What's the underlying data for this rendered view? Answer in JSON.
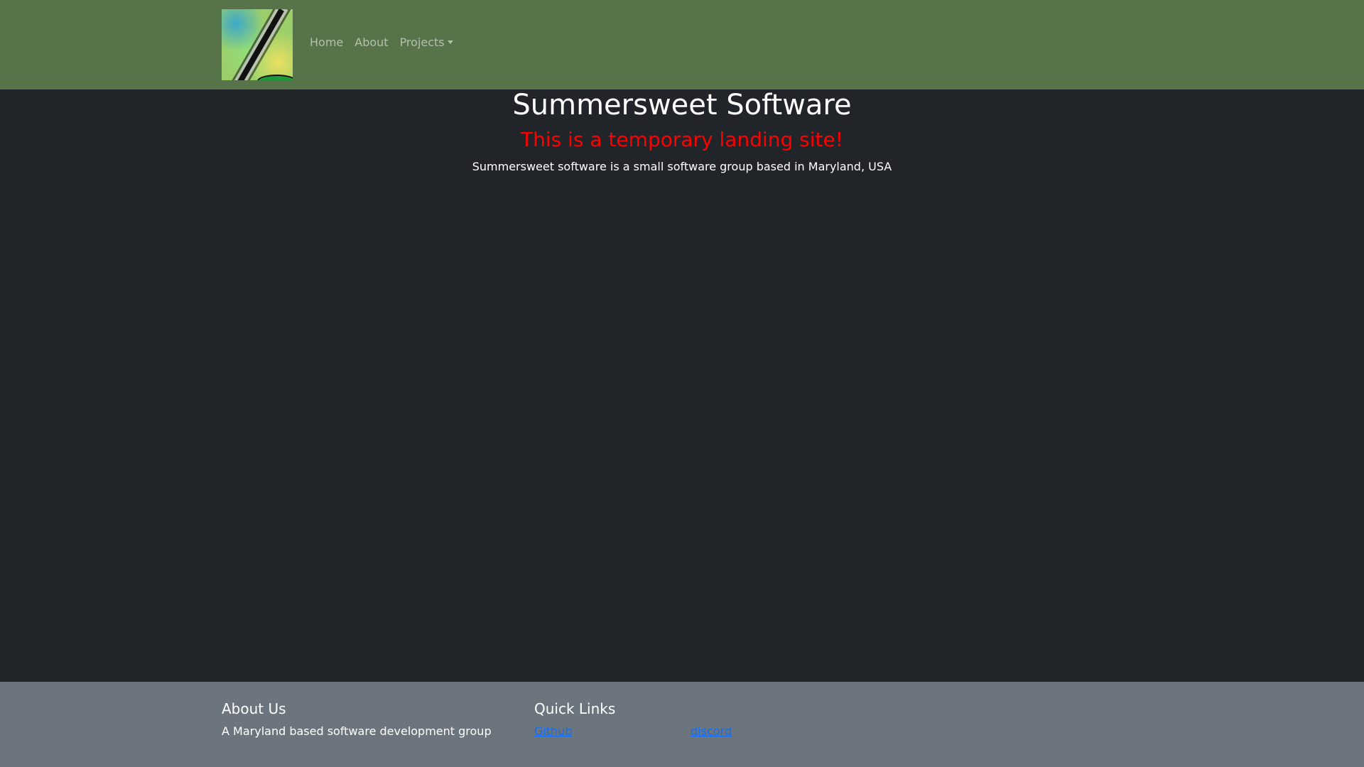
{
  "nav": {
    "home": "Home",
    "about": "About",
    "projects": "Projects"
  },
  "hero": {
    "title": "Summersweet Software",
    "notice": "This is a temporary landing site!",
    "description": "Summersweet software is a small software group based in Maryland, USA"
  },
  "footer": {
    "about_heading": "About Us",
    "about_text": "A Maryland based software development group",
    "links_heading": "Quick Links",
    "links": [
      {
        "label": "Github"
      },
      {
        "label": "discord"
      }
    ]
  }
}
